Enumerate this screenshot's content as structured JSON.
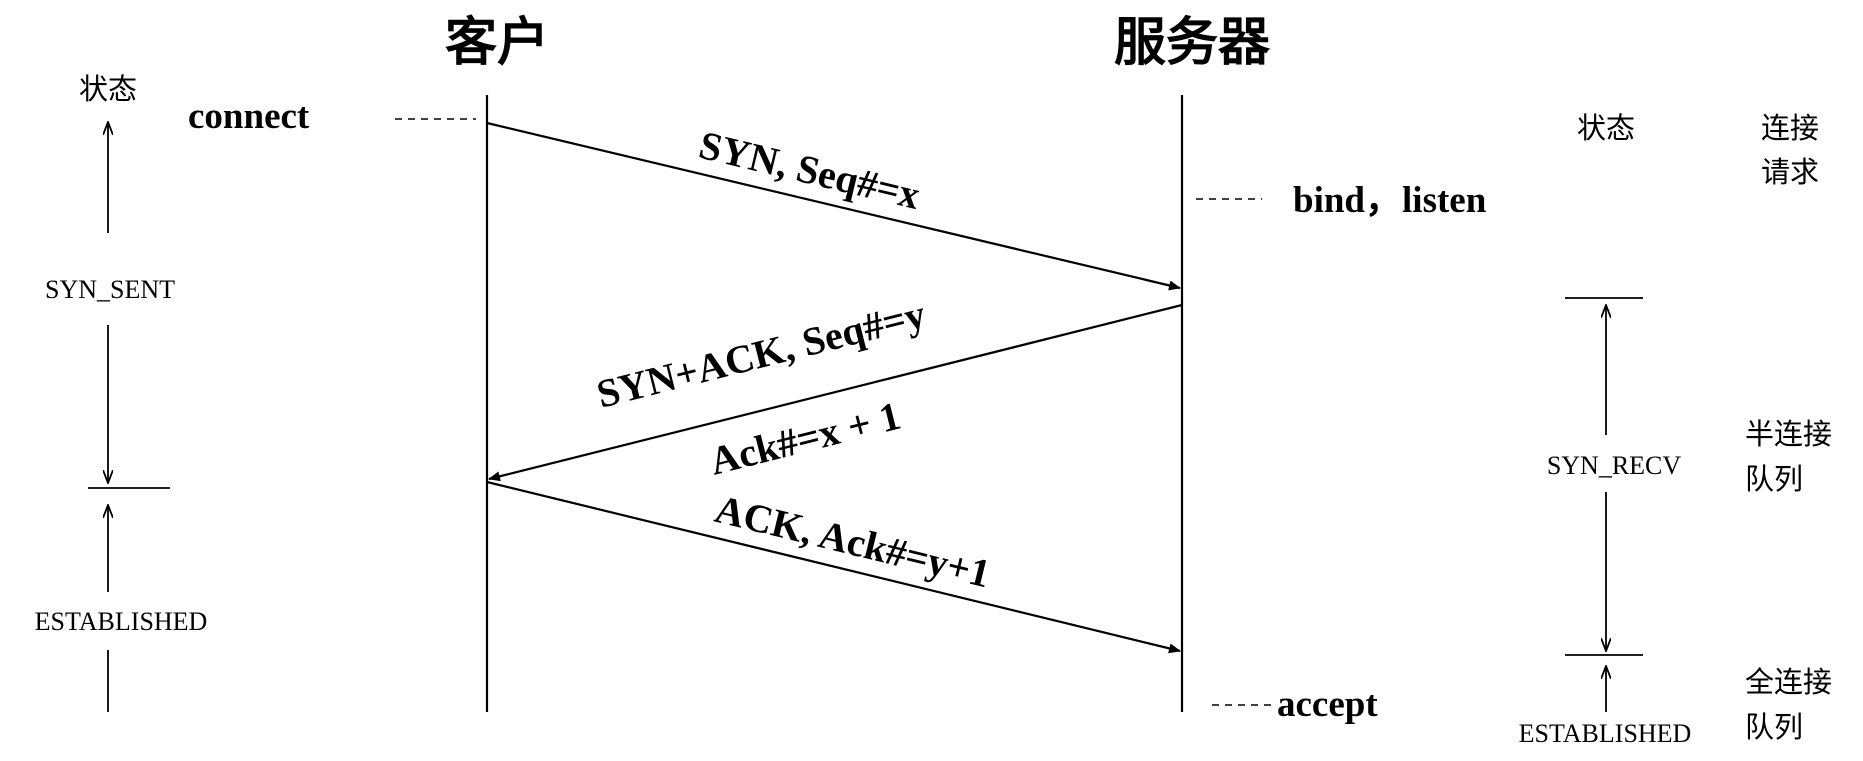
{
  "client_title": "客户",
  "server_title": "服务器",
  "left_state_label": "状态",
  "right_state_label": "状态",
  "client_cmd": "connect",
  "server_cmd_bind": "bind，listen",
  "server_cmd_accept": "accept",
  "messages": {
    "syn": "SYN, Seq#=x",
    "synack_line1": "SYN+ACK, Seq#=y",
    "synack_line2": "Ack#=x + 1",
    "ack": "ACK, Ack#=y+1"
  },
  "client_states": {
    "syn_sent": "SYN_SENT",
    "established": "ESTABLISHED"
  },
  "server_states": {
    "syn_recv": "SYN_RECV",
    "established": "ESTABLISHED"
  },
  "queues": {
    "request_line1": "连接",
    "request_line2": "请求",
    "half_line1": "半连接",
    "half_line2": "队列",
    "full_line1": "全连接",
    "full_line2": "队列"
  }
}
